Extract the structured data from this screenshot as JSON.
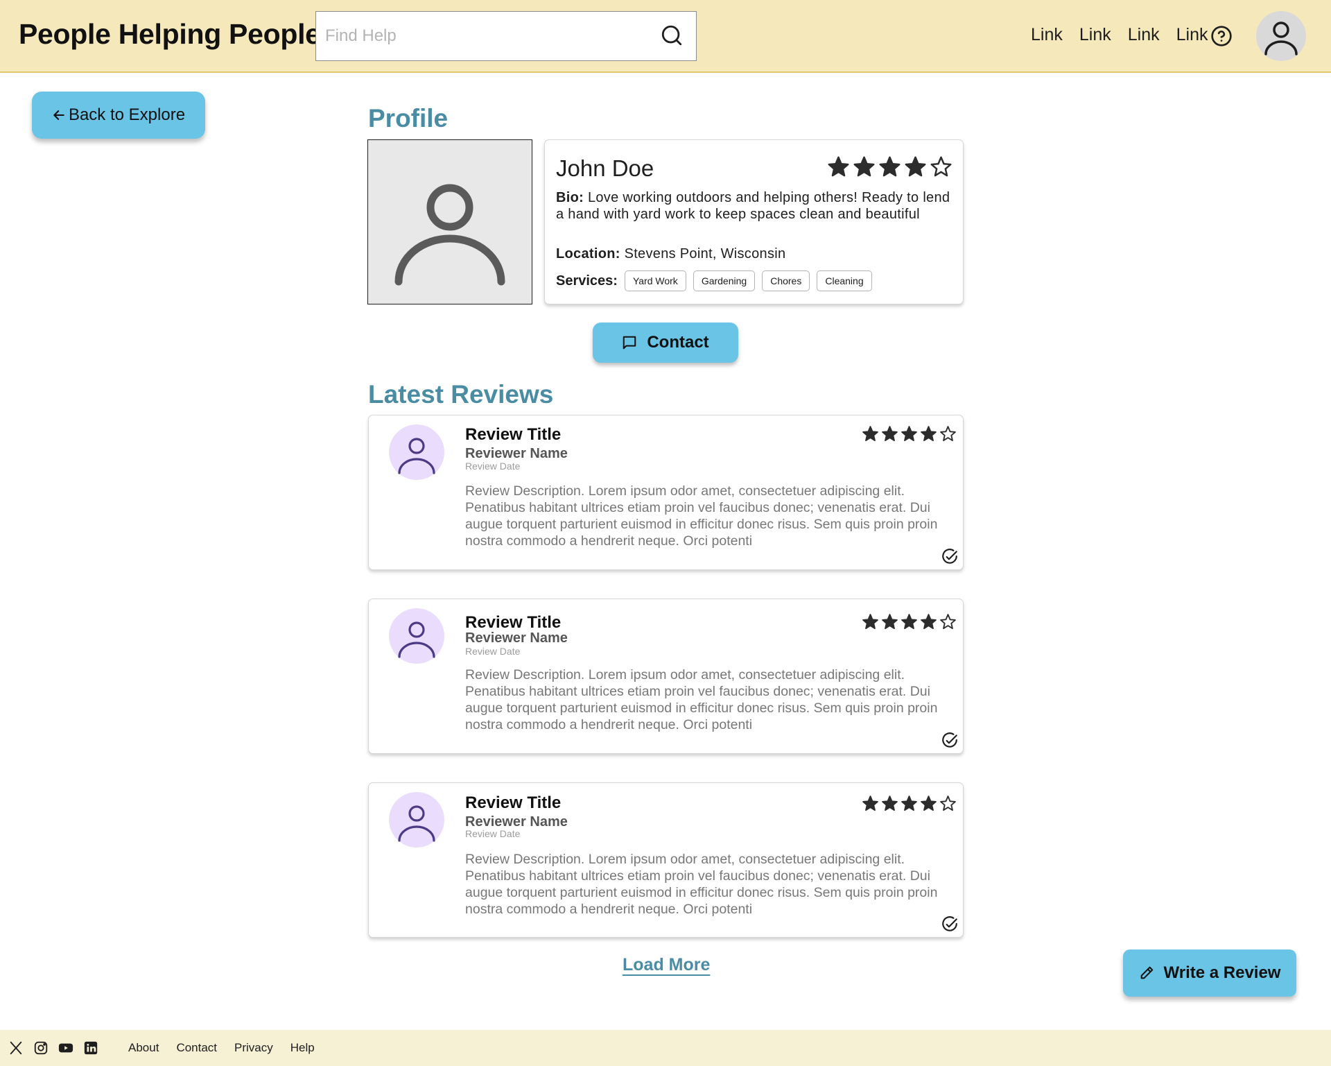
{
  "header": {
    "brand": "People Helping People",
    "search_placeholder": "Find Help",
    "links": [
      "Link",
      "Link",
      "Link",
      "Link"
    ]
  },
  "back_button_label": "Back to Explore",
  "profile": {
    "section_title": "Profile",
    "name": "John Doe",
    "rating": 4,
    "rating_max": 5,
    "bio_label": "Bio:",
    "bio": "Love working outdoors and helping others! Ready to lend a hand with yard work to keep spaces clean and beautiful",
    "location_label": "Location:",
    "location": "Stevens Point, Wisconsin",
    "services_label": "Services:",
    "services": [
      "Yard Work",
      "Gardening",
      "Chores",
      "Cleaning"
    ]
  },
  "contact_button_label": "Contact",
  "reviews_section": {
    "title": "Latest Reviews",
    "reviews": [
      {
        "title": "Review Title",
        "reviewer": "Reviewer Name",
        "date": "Review Date",
        "rating": 4,
        "description": "Review Description. Lorem ipsum odor amet, consectetuer adipiscing elit. Penatibus habitant ultrices etiam proin vel faucibus donec; venenatis erat. Dui augue torquent parturient euismod in efficitur donec risus. Sem quis proin proin nostra commodo a hendrerit neque. Orci potenti"
      },
      {
        "title": "Review Title",
        "reviewer": "Reviewer Name",
        "date": "Review Date",
        "rating": 4,
        "description": "Review Description. Lorem ipsum odor amet, consectetuer adipiscing elit. Penatibus habitant ultrices etiam proin vel faucibus donec; venenatis erat. Dui augue torquent parturient euismod in efficitur donec risus. Sem quis proin proin nostra commodo a hendrerit neque. Orci potenti"
      },
      {
        "title": "Review Title",
        "reviewer": "Reviewer Name",
        "date": "Review Date",
        "rating": 4,
        "description": "Review Description. Lorem ipsum odor amet, consectetuer adipiscing elit. Penatibus habitant ultrices etiam proin vel faucibus donec; venenatis erat. Dui augue torquent parturient euismod in efficitur donec risus. Sem quis proin proin nostra commodo a hendrerit neque. Orci potenti"
      }
    ],
    "load_more_label": "Load More"
  },
  "write_review_label": "Write a Review",
  "footer": {
    "social_icons": [
      "x-icon",
      "instagram-icon",
      "youtube-icon",
      "linkedin-icon"
    ],
    "links": [
      "About",
      "Contact",
      "Privacy",
      "Help"
    ]
  },
  "colors": {
    "header_bg": "#f5e9bb",
    "accent_button": "#6ac4e6",
    "section_title": "#4a8ca3",
    "avatar_bg": "#eadcfd",
    "footer_bg": "#f6f0d5"
  }
}
